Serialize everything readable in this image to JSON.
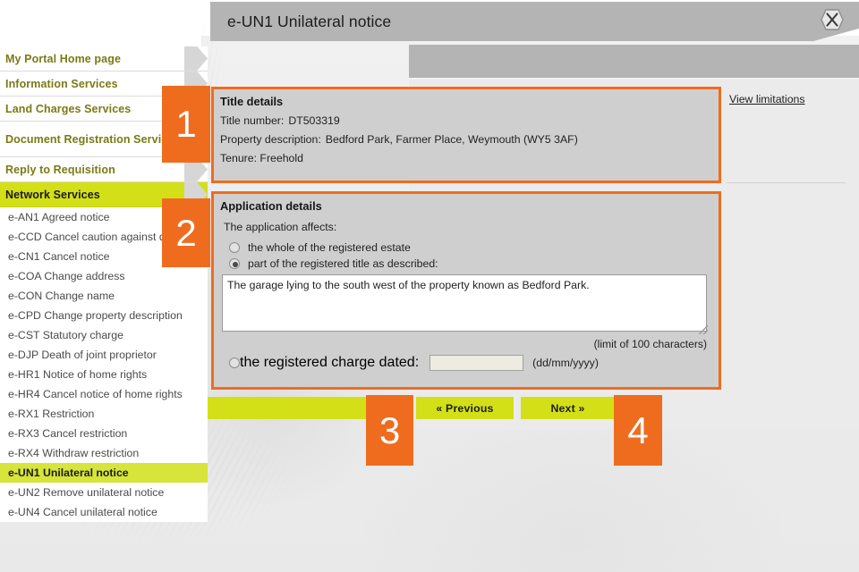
{
  "window": {
    "title": "e-UN1 Unilateral notice",
    "close_icon": "close-icon"
  },
  "sidebar": {
    "primary_items": [
      {
        "label": "My Portal Home page",
        "state": "normal"
      },
      {
        "label": "Information Services",
        "state": "normal"
      },
      {
        "label": "Land Charges Services",
        "state": "normal"
      },
      {
        "label": "Document Registration Service",
        "state": "normal"
      },
      {
        "label": "Reply to Requisition",
        "state": "normal"
      },
      {
        "label": "Network Services",
        "state": "highlight"
      }
    ],
    "sub_items": [
      {
        "label": "e-AN1 Agreed notice",
        "state": "normal"
      },
      {
        "label": "e-CCD Cancel caution against dealings",
        "state": "normal"
      },
      {
        "label": "e-CN1 Cancel notice",
        "state": "normal"
      },
      {
        "label": "e-COA Change address",
        "state": "normal"
      },
      {
        "label": "e-CON Change name",
        "state": "normal"
      },
      {
        "label": "e-CPD Change property description",
        "state": "normal"
      },
      {
        "label": "e-CST Statutory charge",
        "state": "normal"
      },
      {
        "label": "e-DJP Death of joint proprietor",
        "state": "normal"
      },
      {
        "label": "e-HR1 Notice of home rights",
        "state": "normal"
      },
      {
        "label": "e-HR4 Cancel notice of home rights",
        "state": "normal"
      },
      {
        "label": "e-RX1 Restriction",
        "state": "normal"
      },
      {
        "label": "e-RX3 Cancel restriction",
        "state": "normal"
      },
      {
        "label": "e-RX4 Withdraw restriction",
        "state": "normal"
      },
      {
        "label": "e-UN1 Unilateral notice",
        "state": "current"
      },
      {
        "label": "e-UN2 Remove unilateral notice",
        "state": "normal"
      },
      {
        "label": "e-UN4 Cancel unilateral notice",
        "state": "normal"
      }
    ]
  },
  "title_details": {
    "heading": "Title details",
    "title_number_label": "Title number:",
    "title_number_value": "DT503319",
    "property_description_label": "Property description:",
    "property_description_value": "Bedford Park, Farmer Place, Weymouth (WY5 3AF)",
    "tenure_line": "Tenure: Freehold"
  },
  "right_column": {
    "view_limitations_label": "View limitations"
  },
  "application_details": {
    "heading": "Application details",
    "affects_label": "The application affects:",
    "options": [
      {
        "label": "the whole of the registered estate",
        "selected": false
      },
      {
        "label": "part of the registered title as described:",
        "selected": true
      },
      {
        "label": "the registered charge dated:",
        "selected": false
      }
    ],
    "description_value": "The garage lying to the south west of the property known as Bedford Park.",
    "description_placeholder": "",
    "limit_note": "(limit of 100 characters)",
    "date_value": "",
    "date_placeholder": "",
    "date_hint": "(dd/mm/yyyy)"
  },
  "buttons": {
    "previous_label": "« Previous",
    "next_label": "Next »"
  },
  "callouts": {
    "one": "1",
    "two": "2",
    "three": "3",
    "four": "4"
  },
  "colors": {
    "accent_orange": "#ef6c1f",
    "accent_lime": "#d4e017",
    "nav_text": "#7a7a16",
    "titlebar_grey": "#b4b4b4",
    "section_grey": "#cfcfcf"
  }
}
